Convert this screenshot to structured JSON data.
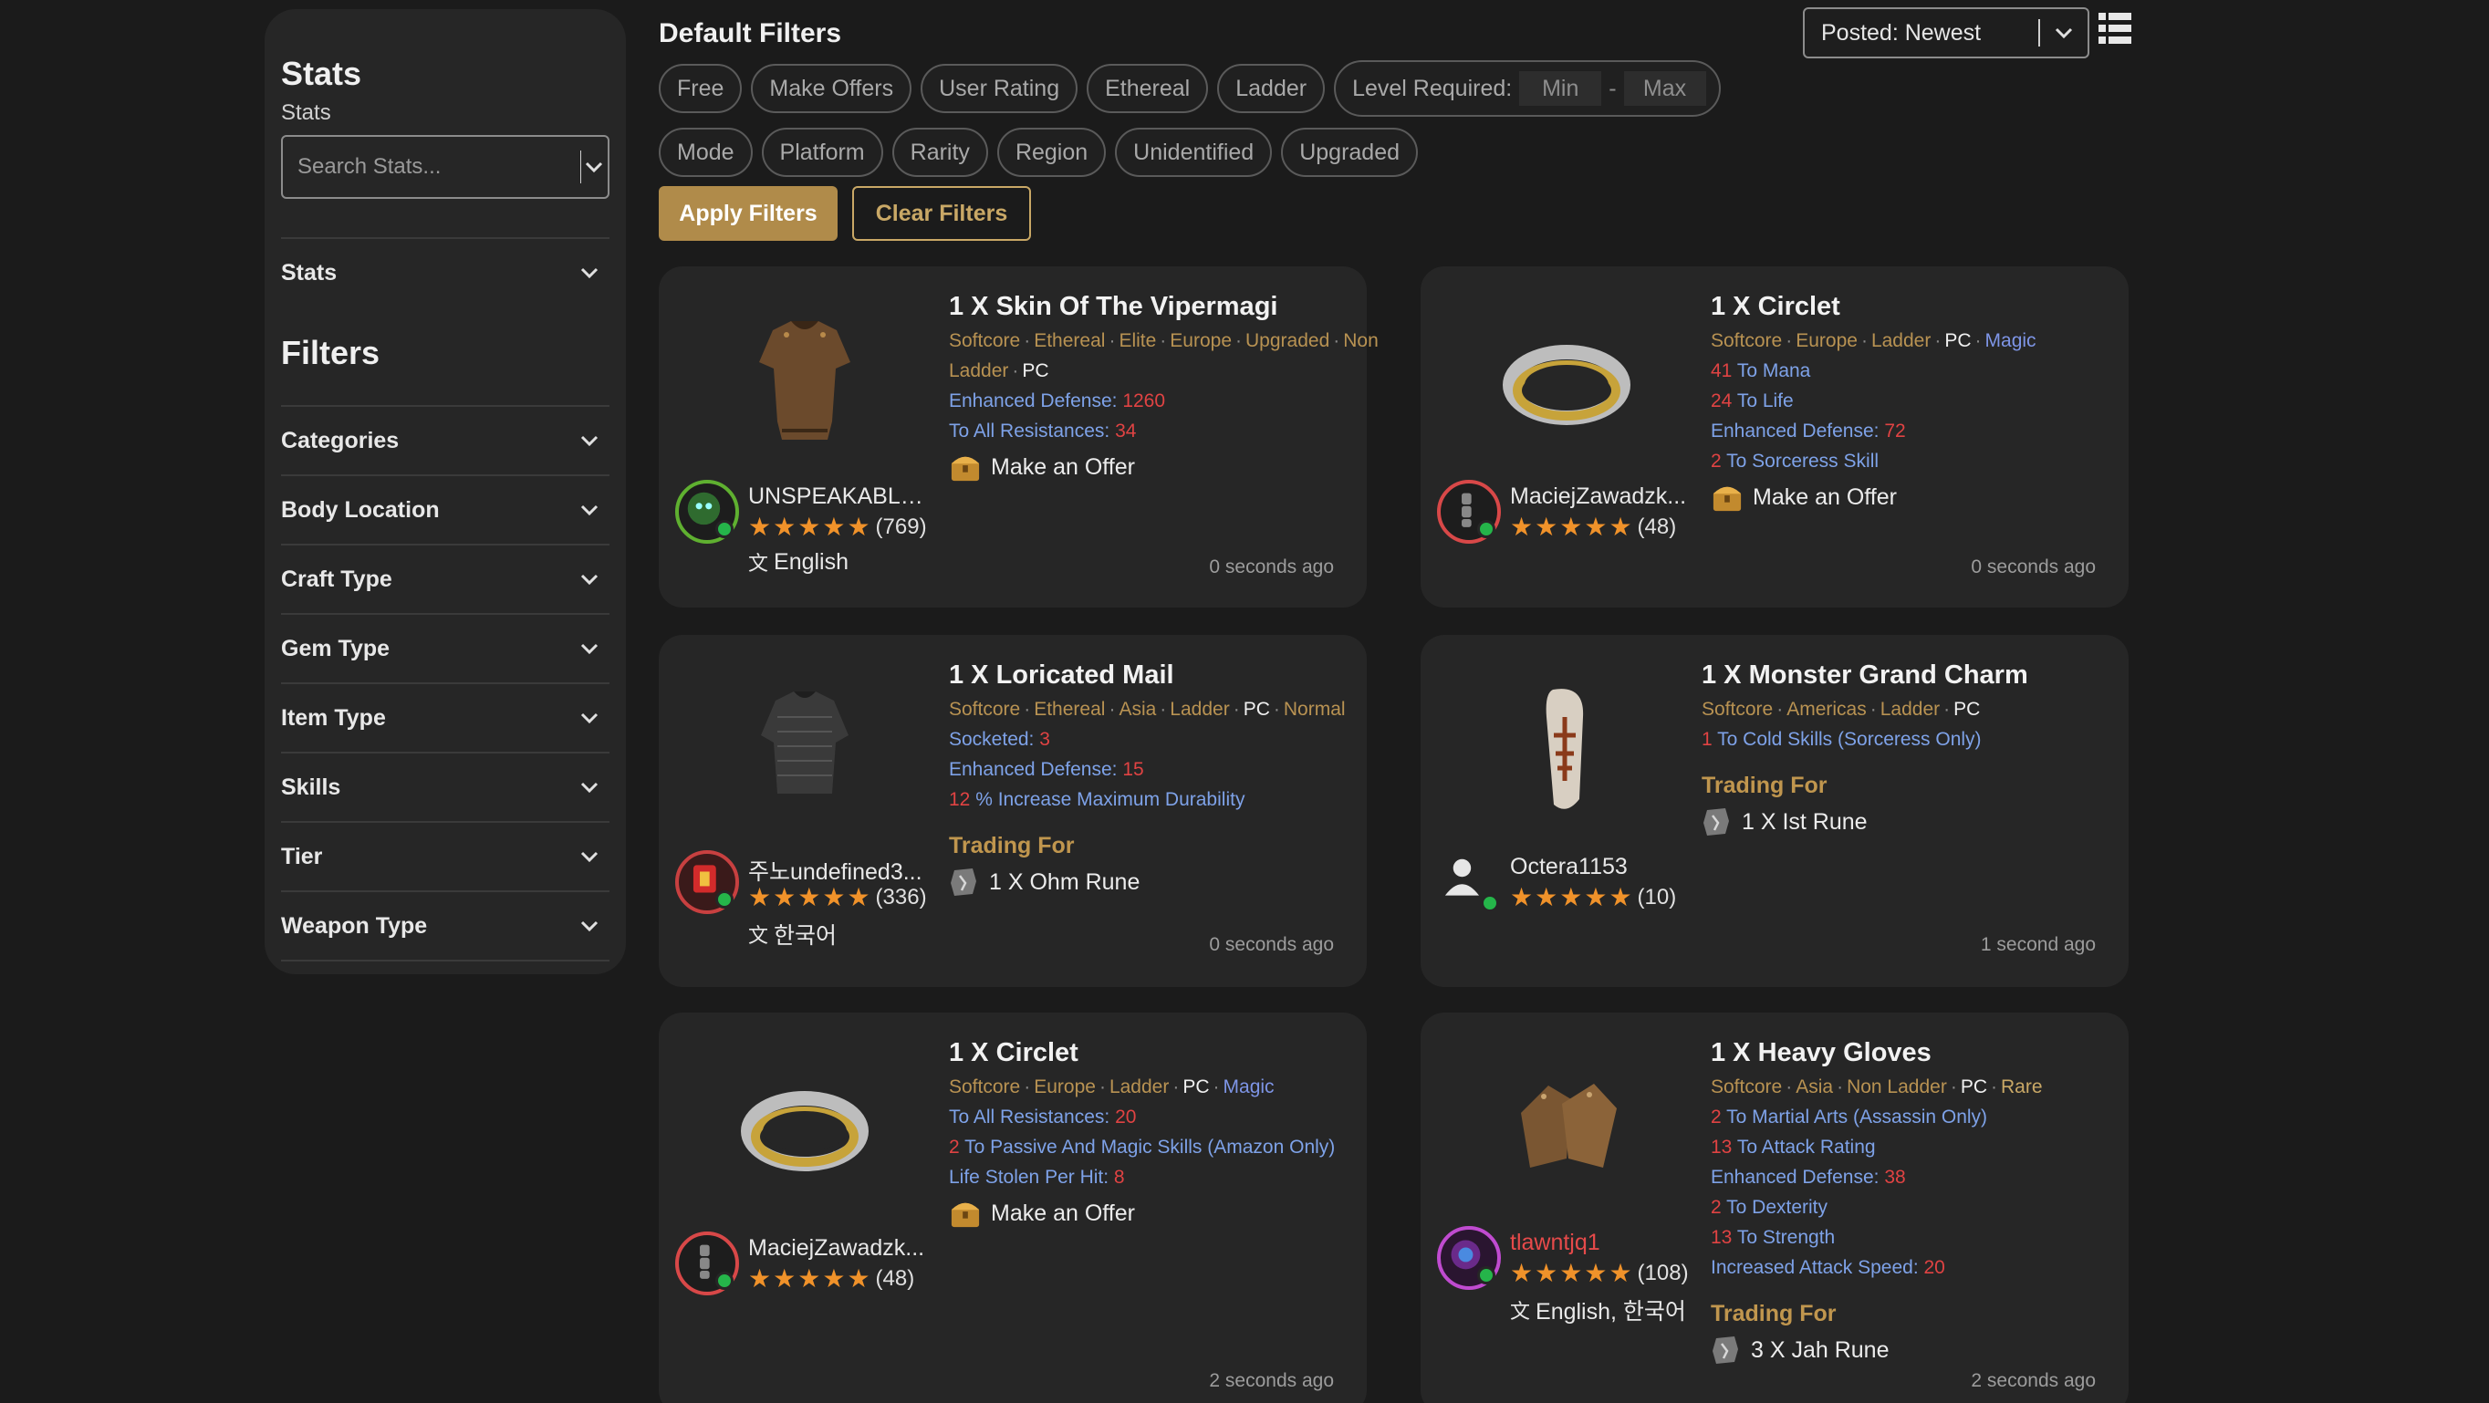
{
  "sidebar": {
    "stats_heading": "Stats",
    "stats_label": "Stats",
    "search_placeholder": "Search Stats...",
    "stats_row": "Stats",
    "filters_heading": "Filters",
    "filters": [
      "Categories",
      "Body Location",
      "Craft Type",
      "Gem Type",
      "Item Type",
      "Skills",
      "Tier",
      "Weapon Type"
    ]
  },
  "header": {
    "title": "Default Filters",
    "sort_label": "Posted: Newest",
    "chips_row1": [
      "Free",
      "Make Offers",
      "User Rating",
      "Ethereal",
      "Ladder"
    ],
    "level_label": "Level Required:",
    "level_min_placeholder": "Min",
    "level_dash": "-",
    "level_max_placeholder": "Max",
    "chips_row2": [
      "Mode",
      "Platform",
      "Rarity",
      "Region",
      "Unidentified",
      "Upgraded"
    ],
    "apply_label": "Apply Filters",
    "clear_label": "Clear Filters"
  },
  "listings": [
    {
      "title": "1 X Skin Of The Vipermagi",
      "tags": [
        "Softcore",
        "Ethereal",
        "Elite",
        "Europe",
        "Upgraded",
        "Non Ladder",
        "PC"
      ],
      "stats": [
        {
          "label": "Enhanced Defense: ",
          "num": "1260"
        },
        {
          "label": "To All Resistances: ",
          "num": "34"
        }
      ],
      "offer": "Make an Offer",
      "seller": "UNSPEAKABLE...",
      "rating": "(769)",
      "language": "English",
      "time": "0 seconds ago"
    },
    {
      "title": "1 X Circlet",
      "tags": [
        "Softcore",
        "Europe",
        "Ladder",
        "PC",
        "Magic"
      ],
      "stats": [
        {
          "num": "41",
          "label": " To Mana"
        },
        {
          "num": "24",
          "label": " To Life"
        },
        {
          "label": "Enhanced Defense: ",
          "num": "72"
        },
        {
          "num": "2",
          "label": " To Sorceress Skill"
        }
      ],
      "offer": "Make an Offer",
      "seller": "MaciejZawadzk...",
      "rating": "(48)",
      "time": "0 seconds ago"
    },
    {
      "title": "1 X Loricated Mail",
      "tags": [
        "Softcore",
        "Ethereal",
        "Asia",
        "Ladder",
        "PC",
        "Normal"
      ],
      "stats": [
        {
          "label": "Socketed: ",
          "num": "3"
        },
        {
          "label": "Enhanced Defense: ",
          "num": "15"
        },
        {
          "num": "12",
          "label": " % Increase Maximum Durability"
        }
      ],
      "trading_for": "Trading For",
      "rune": "1 X Ohm Rune",
      "seller": "주노undefined3...",
      "rating": "(336)",
      "language": "한국어",
      "time": "0 seconds ago"
    },
    {
      "title": "1 X Monster Grand Charm",
      "tags": [
        "Softcore",
        "Americas",
        "Ladder",
        "PC"
      ],
      "stats": [
        {
          "num": "1",
          "label": " To Cold Skills (Sorceress Only)"
        }
      ],
      "trading_for": "Trading For",
      "rune": "1 X Ist Rune",
      "seller": "Octera1153",
      "rating": "(10)",
      "time": "1 second ago"
    },
    {
      "title": "1 X Circlet",
      "tags": [
        "Softcore",
        "Europe",
        "Ladder",
        "PC",
        "Magic"
      ],
      "stats": [
        {
          "label": "To All Resistances: ",
          "num": "20"
        },
        {
          "num": "2",
          "label": " To Passive And Magic Skills (Amazon Only)"
        },
        {
          "label": "Life Stolen Per Hit: ",
          "num": "8"
        }
      ],
      "offer": "Make an Offer",
      "seller": "MaciejZawadzk...",
      "rating": "(48)",
      "time": "2 seconds ago"
    },
    {
      "title": "1 X Heavy Gloves",
      "tags": [
        "Softcore",
        "Asia",
        "Non Ladder",
        "PC",
        "Rare"
      ],
      "stats": [
        {
          "num": "2",
          "label": " To Martial Arts (Assassin Only)"
        },
        {
          "num": "13",
          "label": " To Attack Rating"
        },
        {
          "label": "Enhanced Defense: ",
          "num": "38"
        },
        {
          "num": "2",
          "label": " To Dexterity"
        },
        {
          "num": "13",
          "label": " To Strength"
        },
        {
          "label": "Increased Attack Speed: ",
          "num": "20"
        }
      ],
      "trading_for": "Trading For",
      "rune": "3 X Jah Rune",
      "seller": "tlawntjq1",
      "rating": "(108)",
      "language": "English, 한국어",
      "time": "2 seconds ago"
    }
  ]
}
